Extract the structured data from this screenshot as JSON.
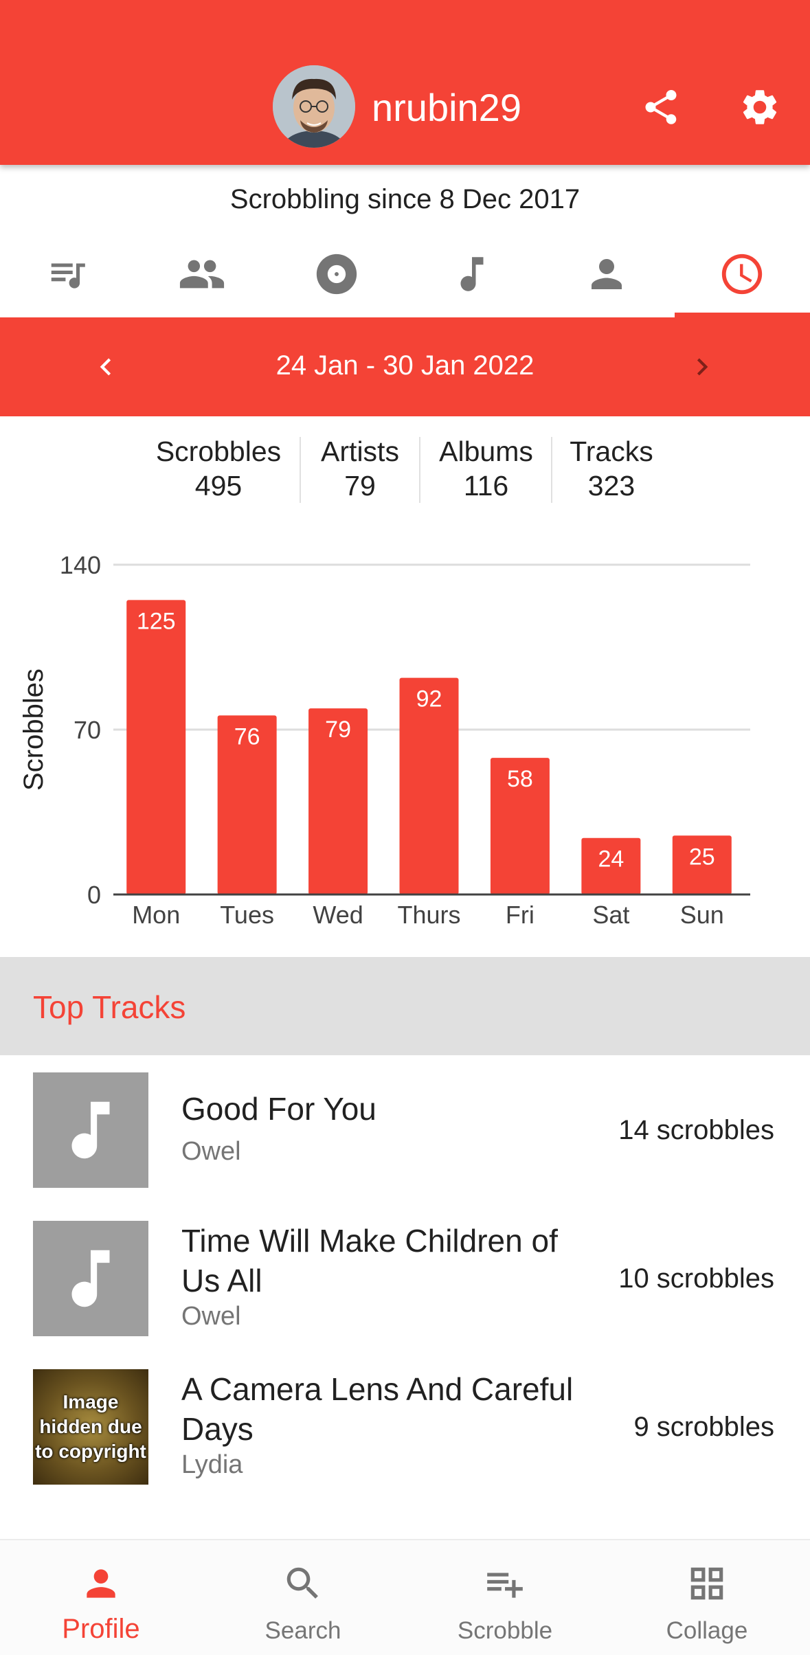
{
  "header": {
    "username": "nrubin29",
    "since": "Scrobbling since 8 Dec 2017",
    "share_icon": "share-icon",
    "settings_icon": "gear-icon",
    "accent": "#f44336"
  },
  "tabs": [
    {
      "icon": "queue-music-icon",
      "active": false
    },
    {
      "icon": "people-icon",
      "active": false
    },
    {
      "icon": "album-icon",
      "active": false
    },
    {
      "icon": "music-note-icon",
      "active": false
    },
    {
      "icon": "person-icon",
      "active": false
    },
    {
      "icon": "clock-icon",
      "active": true
    }
  ],
  "week": {
    "label": "24 Jan - 30 Jan 2022"
  },
  "stats": [
    {
      "label": "Scrobbles",
      "value": "495"
    },
    {
      "label": "Artists",
      "value": "79"
    },
    {
      "label": "Albums",
      "value": "116"
    },
    {
      "label": "Tracks",
      "value": "323"
    }
  ],
  "chart_data": {
    "type": "bar",
    "categories": [
      "Mon",
      "Tues",
      "Wed",
      "Thurs",
      "Fri",
      "Sat",
      "Sun"
    ],
    "values": [
      125,
      76,
      79,
      92,
      58,
      24,
      25
    ],
    "ylabel": "Scrobbles",
    "xlabel": "",
    "ylim": [
      0,
      140
    ],
    "yticks": [
      0,
      70,
      140
    ],
    "grid": true,
    "bar_color": "#f44336"
  },
  "top_tracks": {
    "title": "Top Tracks",
    "items": [
      {
        "title": "Good For You",
        "artist": "Owel",
        "count": "14 scrobbles",
        "art": "music-note"
      },
      {
        "title": "Time Will Make Children of Us All",
        "artist": "Owel",
        "count": "10 scrobbles",
        "art": "music-note"
      },
      {
        "title": "A Camera Lens And Careful Days",
        "artist": "Lydia",
        "count": "9 scrobbles",
        "art": "Image hidden due to copyright"
      }
    ]
  },
  "bottom_nav": [
    {
      "label": "Profile",
      "icon": "person-icon",
      "active": true
    },
    {
      "label": "Search",
      "icon": "search-icon",
      "active": false
    },
    {
      "label": "Scrobble",
      "icon": "playlist-add-icon",
      "active": false
    },
    {
      "label": "Collage",
      "icon": "grid-icon",
      "active": false
    }
  ]
}
